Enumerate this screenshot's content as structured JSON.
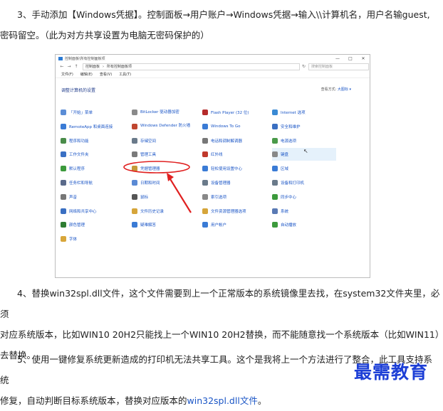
{
  "paragraphs": {
    "p3_line1": "3、手动添加【Windows凭据】。控制面板→用户账户→Windows凭据→输入\\\\计算机名，用户名输guest,",
    "p3_line2": "密码留空。（此为对方共享设置为电脑无密码保护的）",
    "p4_line1": "4、替换win32spl.dll文件，这个文件需要到上一个正常版本的系统镜像里去找，在system32文件夹里，必须",
    "p4_line2": "对应系统版本，比如WIN10 20H2只能找上一个WIN10 20H2替换，而不能随意找一个系统版本（比如WIN11）",
    "p4_line3": "去替换。",
    "p5_line1": "5、使用一键修复系统更新造成的打印机无法共享工具。这个是我将上一个方法进行了整合，此工具支持系统",
    "p5_line2_prefix": "修复，自动判断目标系统版本，替换对应版本的",
    "p5_line2_link": "win32spl.dll文件",
    "p5_line2_suffix": "。"
  },
  "screenshot": {
    "title": "控制面板\\所有控制面板项",
    "window_buttons": [
      "—",
      "□",
      "✕"
    ],
    "nav": [
      "←",
      "→",
      "↑"
    ],
    "address_segments": [
      "控制面板",
      "所有控制面板项"
    ],
    "search_placeholder": "搜索控制面板",
    "menu": [
      "文件(F)",
      "编辑(E)",
      "查看(V)",
      "工具(T)"
    ],
    "heading": "调整计算机的设置",
    "view_by_label": "查看方式:",
    "view_by_value": "大图标 ▾",
    "columns": [
      [
        {
          "label": "「开始」菜单",
          "icon": "start-menu-icon",
          "color": "#5b8dd6"
        },
        {
          "label": "RemoteApp 和桌面连接",
          "icon": "remote-desktop-icon",
          "color": "#3a7bd5"
        },
        {
          "label": "程序和功能",
          "icon": "programs-icon",
          "color": "#4a8c4a"
        },
        {
          "label": "工作文件夹",
          "icon": "work-folders-icon",
          "color": "#3a70c4"
        },
        {
          "label": "默认程序",
          "icon": "default-programs-icon",
          "color": "#3c9a3c"
        },
        {
          "label": "任务栏和导航",
          "icon": "taskbar-icon",
          "color": "#5a6a8a"
        },
        {
          "label": "声音",
          "icon": "sound-icon",
          "color": "#777777"
        },
        {
          "label": "网络和共享中心",
          "icon": "network-icon",
          "color": "#3a6fc2"
        },
        {
          "label": "颜色管理",
          "icon": "color-management-icon",
          "color": "#2e7d32"
        },
        {
          "label": "字体",
          "icon": "fonts-icon",
          "color": "#d8a63a"
        }
      ],
      [
        {
          "label": "BitLocker 驱动器加密",
          "icon": "bitlocker-icon",
          "color": "#8a8a8a"
        },
        {
          "label": "Windows Defender 防火墙",
          "icon": "firewall-icon",
          "color": "#c0462f"
        },
        {
          "label": "存储空间",
          "icon": "storage-spaces-icon",
          "color": "#6a7a8a"
        },
        {
          "label": "管理工具",
          "icon": "admin-tools-icon",
          "color": "#7a7a7a"
        },
        {
          "label": "凭据管理器",
          "icon": "credential-manager-icon",
          "color": "#c49a3a"
        },
        {
          "label": "日期和时间",
          "icon": "date-time-icon",
          "color": "#5a8ad4"
        },
        {
          "label": "鼠标",
          "icon": "mouse-icon",
          "color": "#555555"
        },
        {
          "label": "文件历史记录",
          "icon": "file-history-icon",
          "color": "#d6a53a"
        },
        {
          "label": "疑难解答",
          "icon": "troubleshooting-icon",
          "color": "#3a7bd5"
        }
      ],
      [
        {
          "label": "Flash Player (32 位)",
          "icon": "flash-player-icon",
          "color": "#b52b2b"
        },
        {
          "label": "Windows To Go",
          "icon": "windows-to-go-icon",
          "color": "#3a7bd5"
        },
        {
          "label": "电话和调制解调器",
          "icon": "phone-modem-icon",
          "color": "#777777"
        },
        {
          "label": "红外线",
          "icon": "infrared-icon",
          "color": "#c0392b"
        },
        {
          "label": "轻松使用设置中心",
          "icon": "ease-of-access-icon",
          "color": "#3a7bd5"
        },
        {
          "label": "设备管理器",
          "icon": "device-manager-icon",
          "color": "#6a7a8a"
        },
        {
          "label": "索引选项",
          "icon": "indexing-icon",
          "color": "#888888"
        },
        {
          "label": "文件资源管理器选项",
          "icon": "explorer-options-icon",
          "color": "#d6a53a"
        },
        {
          "label": "用户帐户",
          "icon": "user-accounts-icon",
          "color": "#3a7bd5"
        }
      ],
      [
        {
          "label": "Internet 选项",
          "icon": "internet-options-icon",
          "color": "#3a8ad4"
        },
        {
          "label": "安全和维护",
          "icon": "security-maintenance-icon",
          "color": "#3a6fc2"
        },
        {
          "label": "电源选项",
          "icon": "power-options-icon",
          "color": "#4a9a4a"
        },
        {
          "label": "键盘",
          "icon": "keyboard-icon",
          "color": "#888888"
        },
        {
          "label": "区域",
          "icon": "region-icon",
          "color": "#3a7bd5"
        },
        {
          "label": "设备和打印机",
          "icon": "devices-printers-icon",
          "color": "#6a7a8a"
        },
        {
          "label": "同步中心",
          "icon": "sync-center-icon",
          "color": "#3c9a3c"
        },
        {
          "label": "系统",
          "icon": "system-icon",
          "color": "#5a7ab4"
        },
        {
          "label": "自动播放",
          "icon": "autoplay-icon",
          "color": "#3c9a3c"
        }
      ]
    ]
  },
  "annotation_color": "#e02020",
  "watermark": "最需教育"
}
